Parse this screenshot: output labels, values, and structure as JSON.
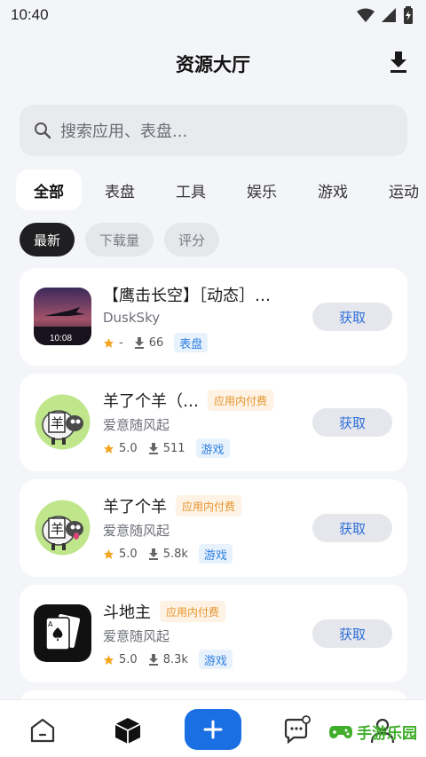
{
  "status_bar": {
    "time": "10:40"
  },
  "header": {
    "title": "资源大厅"
  },
  "search": {
    "placeholder": "搜索应用、表盘..."
  },
  "category_tabs": [
    "全部",
    "表盘",
    "工具",
    "娱乐",
    "游戏",
    "运动"
  ],
  "sort_chips": [
    "最新",
    "下载量",
    "评分"
  ],
  "apps": [
    {
      "name": "【鹰击长空】［动态］…",
      "developer": "DuskSky",
      "rating": "-",
      "downloads": "66",
      "tag": "表盘",
      "in_app_purchase": "",
      "button": "获取",
      "icon_time": "10:08"
    },
    {
      "name": "羊了个羊（…",
      "developer": "爱意随风起",
      "rating": "5.0",
      "downloads": "511",
      "tag": "游戏",
      "in_app_purchase": "应用内付费",
      "button": "获取"
    },
    {
      "name": "羊了个羊",
      "developer": "爱意随风起",
      "rating": "5.0",
      "downloads": "5.8k",
      "tag": "游戏",
      "in_app_purchase": "应用内付费",
      "button": "获取"
    },
    {
      "name": "斗地主",
      "developer": "爱意随风起",
      "rating": "5.0",
      "downloads": "8.3k",
      "tag": "游戏",
      "in_app_purchase": "应用内付费",
      "button": "获取"
    }
  ],
  "watermark": {
    "text": "手游乐园"
  },
  "colors": {
    "accent": "#1a6fe3",
    "star": "#f5a623",
    "tag_blue": "#2f7fe0",
    "badge_orange": "#e6942e"
  }
}
